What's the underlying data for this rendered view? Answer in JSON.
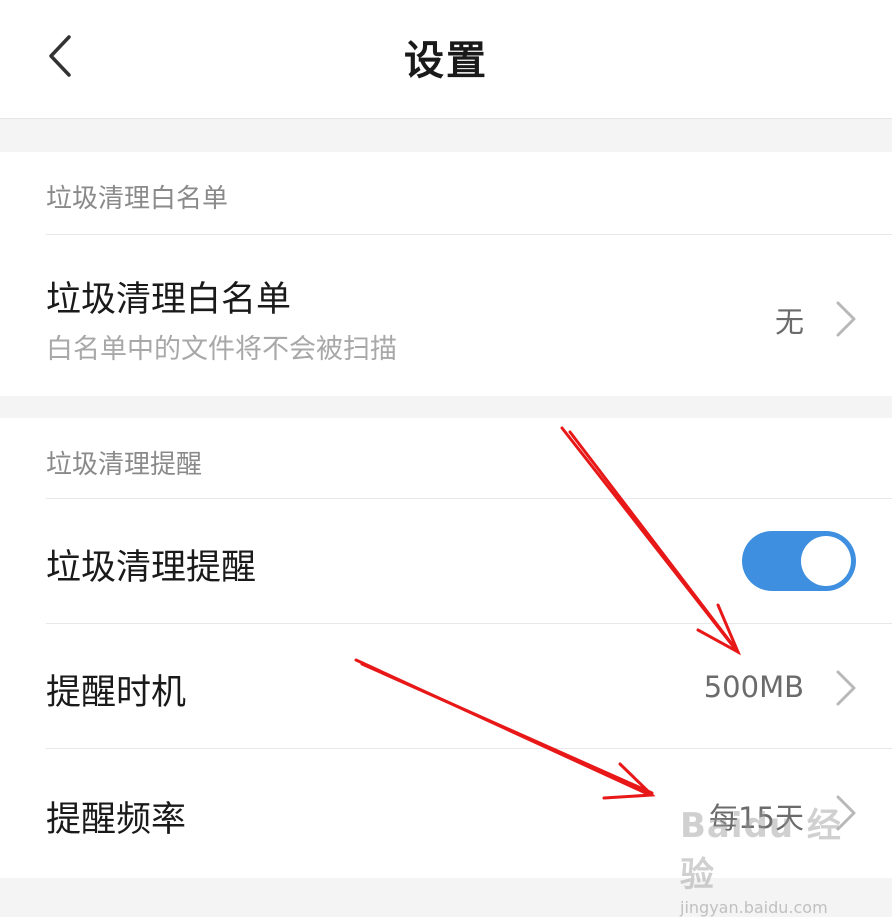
{
  "header": {
    "title": "设置",
    "back_icon": "chevron-left-icon"
  },
  "whitelist_section": {
    "header": "垃圾清理白名单",
    "item": {
      "title": "垃圾清理白名单",
      "subtitle": "白名单中的文件将不会被扫描",
      "value": "无"
    }
  },
  "reminder_section": {
    "header": "垃圾清理提醒",
    "toggle_item": {
      "title": "垃圾清理提醒",
      "enabled": true
    },
    "timing_item": {
      "title": "提醒时机",
      "value": "500MB"
    },
    "frequency_item": {
      "title": "提醒频率",
      "value": "每15天"
    }
  },
  "watermark": {
    "brand": "Baidu 经验",
    "domain": "jingyan.baidu.com"
  },
  "colors": {
    "toggle_on": "#3f8fe0",
    "annotation_arrow": "#e81818",
    "background": "#f4f4f4"
  }
}
